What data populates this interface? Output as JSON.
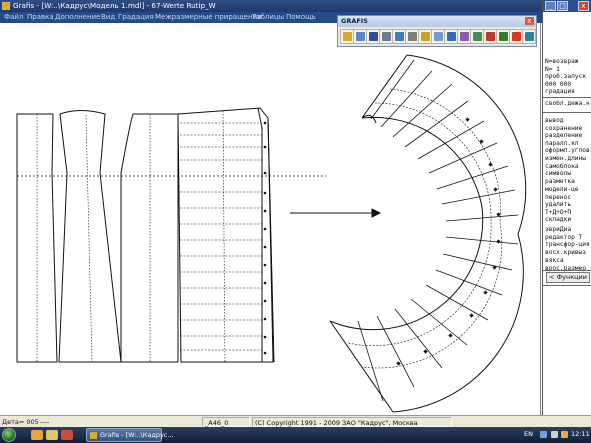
{
  "window": {
    "title": "Grafis - [W:..\\Кадрус\\Модель 1.mdl] - 67-Werte Rutip_W"
  },
  "menu": [
    "Файл",
    "Правка",
    "Дополнение",
    "Вид",
    "Градация",
    "Межразмерные приращения",
    "Таблицы",
    "Помощь"
  ],
  "toolbar": {
    "title": "GRAFIS",
    "close": "x",
    "icons": [
      {
        "name": "open-folder-icon",
        "color": "#d8a632"
      },
      {
        "name": "load-icon",
        "color": "#5a86c9"
      },
      {
        "name": "save-icon",
        "color": "#2f4f8f"
      },
      {
        "name": "zoom-icon",
        "color": "#6c7c8e"
      },
      {
        "name": "print-icon",
        "color": "#3a7dbf"
      },
      {
        "name": "layout-icon",
        "color": "#7d7d7d"
      },
      {
        "name": "measure-icon",
        "color": "#caa12a"
      },
      {
        "name": "table-icon",
        "color": "#6f9bd0"
      },
      {
        "name": "globe-icon",
        "color": "#2f6fb5"
      },
      {
        "name": "tools-icon",
        "color": "#8a5ab0"
      },
      {
        "name": "settings-icon",
        "color": "#3f8f57"
      },
      {
        "name": "export-icon",
        "color": "#c0392b"
      },
      {
        "name": "import-icon",
        "color": "#2e7d32"
      },
      {
        "name": "stop-icon",
        "color": "#d63b2a"
      },
      {
        "name": "monitor-icon",
        "color": "#2d7fa3"
      }
    ]
  },
  "window_controls": {
    "minimize": "_",
    "maximize": "□",
    "close": "x"
  },
  "right_panel": {
    "top_lines": [
      "N=возвраж",
      "N=  1",
      "проб.запуск",
      " 000 000",
      "градация"
    ],
    "group1": [
      "свобл.дежа.н"
    ],
    "group2": [
      "вывод",
      "сохранение",
      "разделение",
      "паралл.кл",
      "оформл.углов",
      "измен.длины",
      "самоблока",
      "символы",
      "разметка"
    ],
    "group3": [
      "модели-це",
      "перенос",
      "удалить",
      "Т+Д+О+П",
      "складки"
    ],
    "group4": [
      "эвриДиа",
      "редактор Т",
      "трансфор-ция",
      "восх.кривыз"
    ],
    "group5": [
      "вякса",
      "врос.размер"
    ],
    "functions_button": "< Функции"
  },
  "status": {
    "detail": "Дета= 005",
    "detail_suffix": "----",
    "size": "_A46_0",
    "copyright": "(C) Copyright 1991 - 2009 ЗАО \"Кадрус\", Москва"
  },
  "taskbar": {
    "task_label": "Grafis - [W:..\\Кадрус...",
    "lang": "EN",
    "clock": "12:11"
  }
}
